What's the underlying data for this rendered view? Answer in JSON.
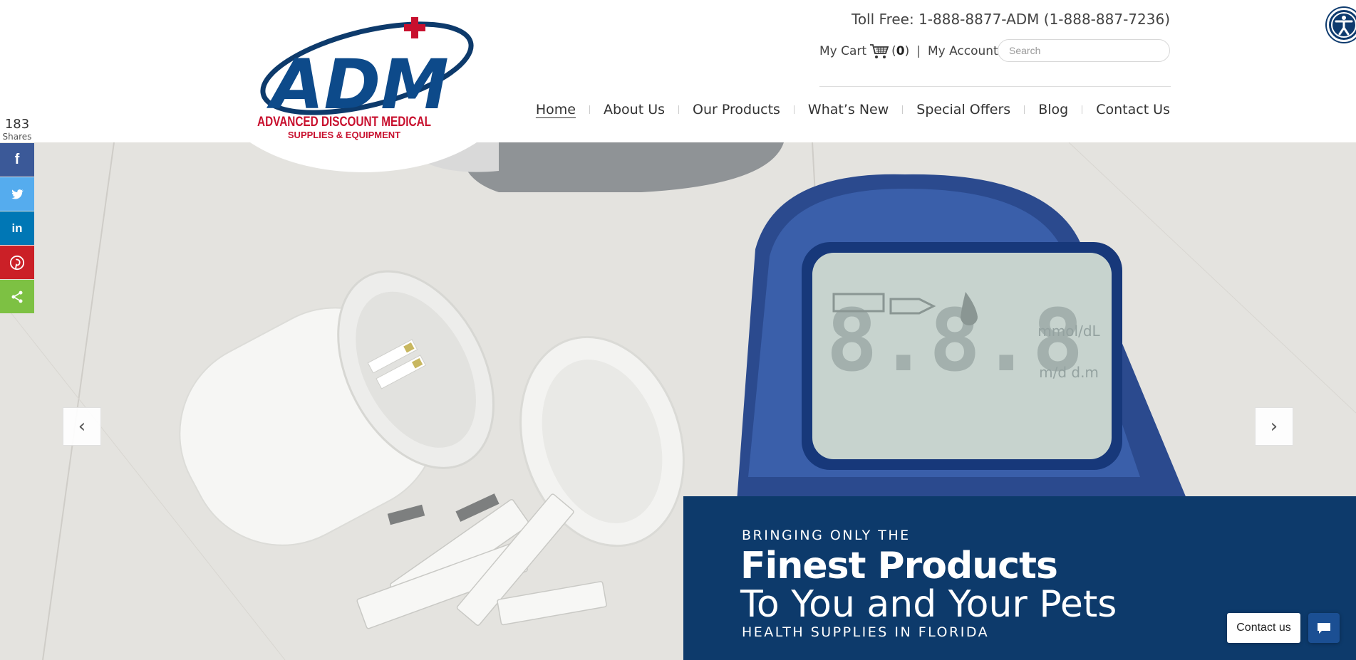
{
  "brand": {
    "logo_main": "ADM",
    "logo_line1": "ADVANCED DISCOUNT MEDICAL",
    "logo_line2": "SUPPLIES & EQUIPMENT",
    "colors": {
      "navy": "#0d3a6b",
      "red": "#c8102e"
    }
  },
  "header": {
    "tollfree": "Toll Free: 1-888-8877-ADM (1-888-887-7236)",
    "cart_label": "My Cart",
    "cart_open": "(",
    "cart_count": "0",
    "cart_close": ")",
    "separator": "|",
    "account_label": "My Account",
    "search_placeholder": "Search"
  },
  "nav": [
    {
      "label": "Home"
    },
    {
      "label": "About Us"
    },
    {
      "label": "Our Products"
    },
    {
      "label": "What’s New"
    },
    {
      "label": "Special Offers"
    },
    {
      "label": "Blog"
    },
    {
      "label": "Contact Us"
    }
  ],
  "share": {
    "count": "183",
    "label": "Shares",
    "buttons": [
      {
        "name": "facebook",
        "glyph": "f",
        "color": "#3b5998"
      },
      {
        "name": "twitter",
        "glyph": "🐦",
        "color": "#55acee"
      },
      {
        "name": "linkedin",
        "glyph": "in",
        "color": "#0077b5"
      },
      {
        "name": "pinterest",
        "glyph": "P",
        "color": "#cb2027"
      },
      {
        "name": "share",
        "glyph": "<",
        "color": "#7dc143"
      }
    ]
  },
  "hero": {
    "prev_arrow": "‹",
    "next_arrow": "›",
    "meter_digits": "8.8.8",
    "meter_units": "mmol/dL",
    "meter_units2": "m/d d.m"
  },
  "promo": {
    "line1": "BRINGING ONLY THE",
    "line2": "Finest Products",
    "line3": "To You and Your Pets",
    "line4": "HEALTH SUPPLIES IN FLORIDA"
  },
  "widgets": {
    "contact_label": "Contact us"
  }
}
